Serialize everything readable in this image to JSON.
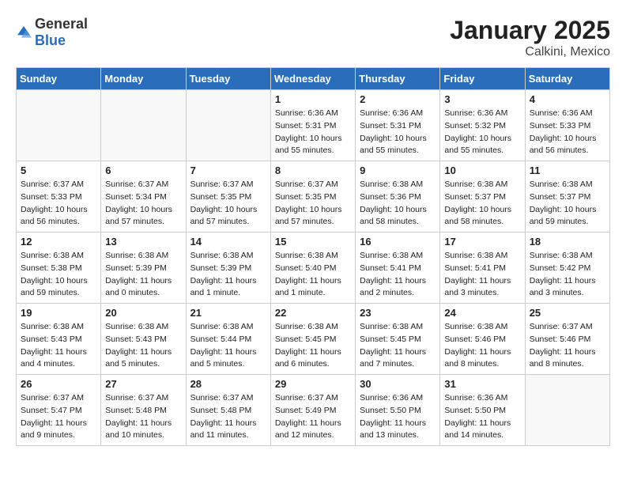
{
  "logo": {
    "text_general": "General",
    "text_blue": "Blue"
  },
  "title": "January 2025",
  "subtitle": "Calkini, Mexico",
  "weekdays": [
    "Sunday",
    "Monday",
    "Tuesday",
    "Wednesday",
    "Thursday",
    "Friday",
    "Saturday"
  ],
  "weeks": [
    [
      {
        "day": "",
        "info": ""
      },
      {
        "day": "",
        "info": ""
      },
      {
        "day": "",
        "info": ""
      },
      {
        "day": "1",
        "info": "Sunrise: 6:36 AM\nSunset: 5:31 PM\nDaylight: 10 hours\nand 55 minutes."
      },
      {
        "day": "2",
        "info": "Sunrise: 6:36 AM\nSunset: 5:31 PM\nDaylight: 10 hours\nand 55 minutes."
      },
      {
        "day": "3",
        "info": "Sunrise: 6:36 AM\nSunset: 5:32 PM\nDaylight: 10 hours\nand 55 minutes."
      },
      {
        "day": "4",
        "info": "Sunrise: 6:36 AM\nSunset: 5:33 PM\nDaylight: 10 hours\nand 56 minutes."
      }
    ],
    [
      {
        "day": "5",
        "info": "Sunrise: 6:37 AM\nSunset: 5:33 PM\nDaylight: 10 hours\nand 56 minutes."
      },
      {
        "day": "6",
        "info": "Sunrise: 6:37 AM\nSunset: 5:34 PM\nDaylight: 10 hours\nand 57 minutes."
      },
      {
        "day": "7",
        "info": "Sunrise: 6:37 AM\nSunset: 5:35 PM\nDaylight: 10 hours\nand 57 minutes."
      },
      {
        "day": "8",
        "info": "Sunrise: 6:37 AM\nSunset: 5:35 PM\nDaylight: 10 hours\nand 57 minutes."
      },
      {
        "day": "9",
        "info": "Sunrise: 6:38 AM\nSunset: 5:36 PM\nDaylight: 10 hours\nand 58 minutes."
      },
      {
        "day": "10",
        "info": "Sunrise: 6:38 AM\nSunset: 5:37 PM\nDaylight: 10 hours\nand 58 minutes."
      },
      {
        "day": "11",
        "info": "Sunrise: 6:38 AM\nSunset: 5:37 PM\nDaylight: 10 hours\nand 59 minutes."
      }
    ],
    [
      {
        "day": "12",
        "info": "Sunrise: 6:38 AM\nSunset: 5:38 PM\nDaylight: 10 hours\nand 59 minutes."
      },
      {
        "day": "13",
        "info": "Sunrise: 6:38 AM\nSunset: 5:39 PM\nDaylight: 11 hours\nand 0 minutes."
      },
      {
        "day": "14",
        "info": "Sunrise: 6:38 AM\nSunset: 5:39 PM\nDaylight: 11 hours\nand 1 minute."
      },
      {
        "day": "15",
        "info": "Sunrise: 6:38 AM\nSunset: 5:40 PM\nDaylight: 11 hours\nand 1 minute."
      },
      {
        "day": "16",
        "info": "Sunrise: 6:38 AM\nSunset: 5:41 PM\nDaylight: 11 hours\nand 2 minutes."
      },
      {
        "day": "17",
        "info": "Sunrise: 6:38 AM\nSunset: 5:41 PM\nDaylight: 11 hours\nand 3 minutes."
      },
      {
        "day": "18",
        "info": "Sunrise: 6:38 AM\nSunset: 5:42 PM\nDaylight: 11 hours\nand 3 minutes."
      }
    ],
    [
      {
        "day": "19",
        "info": "Sunrise: 6:38 AM\nSunset: 5:43 PM\nDaylight: 11 hours\nand 4 minutes."
      },
      {
        "day": "20",
        "info": "Sunrise: 6:38 AM\nSunset: 5:43 PM\nDaylight: 11 hours\nand 5 minutes."
      },
      {
        "day": "21",
        "info": "Sunrise: 6:38 AM\nSunset: 5:44 PM\nDaylight: 11 hours\nand 5 minutes."
      },
      {
        "day": "22",
        "info": "Sunrise: 6:38 AM\nSunset: 5:45 PM\nDaylight: 11 hours\nand 6 minutes."
      },
      {
        "day": "23",
        "info": "Sunrise: 6:38 AM\nSunset: 5:45 PM\nDaylight: 11 hours\nand 7 minutes."
      },
      {
        "day": "24",
        "info": "Sunrise: 6:38 AM\nSunset: 5:46 PM\nDaylight: 11 hours\nand 8 minutes."
      },
      {
        "day": "25",
        "info": "Sunrise: 6:37 AM\nSunset: 5:46 PM\nDaylight: 11 hours\nand 8 minutes."
      }
    ],
    [
      {
        "day": "26",
        "info": "Sunrise: 6:37 AM\nSunset: 5:47 PM\nDaylight: 11 hours\nand 9 minutes."
      },
      {
        "day": "27",
        "info": "Sunrise: 6:37 AM\nSunset: 5:48 PM\nDaylight: 11 hours\nand 10 minutes."
      },
      {
        "day": "28",
        "info": "Sunrise: 6:37 AM\nSunset: 5:48 PM\nDaylight: 11 hours\nand 11 minutes."
      },
      {
        "day": "29",
        "info": "Sunrise: 6:37 AM\nSunset: 5:49 PM\nDaylight: 11 hours\nand 12 minutes."
      },
      {
        "day": "30",
        "info": "Sunrise: 6:36 AM\nSunset: 5:50 PM\nDaylight: 11 hours\nand 13 minutes."
      },
      {
        "day": "31",
        "info": "Sunrise: 6:36 AM\nSunset: 5:50 PM\nDaylight: 11 hours\nand 14 minutes."
      },
      {
        "day": "",
        "info": ""
      }
    ]
  ]
}
